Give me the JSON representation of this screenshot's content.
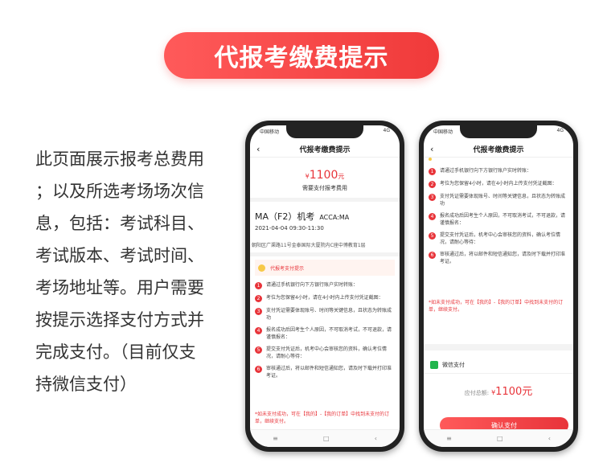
{
  "title": "代报考缴费提示",
  "description_lines": [
    "此页面展示报考总费用",
    "；以及所选考场场次信",
    "息，包括：考试科目、",
    "考试版本、考试时间、",
    "考场地址等。用户需要",
    "按提示选择支付方式并",
    "完成支付。（目前仅支",
    "持微信支付）"
  ],
  "status": {
    "carrier": "中国移动",
    "signal": "4G"
  },
  "page": {
    "back_icon": "‹",
    "nav_title": "代报考缴费提示"
  },
  "summary": {
    "currency": "¥",
    "amount": "1100",
    "unit": "元",
    "subtitle": "需要支付报考费用"
  },
  "exam": {
    "name": "MA（F2）机考",
    "version": "ACCA:MA",
    "time": "2021-04-04 09:30-11:30",
    "address": "朝阳区广渠路11号金泰国际大厦院内C座中博教育1层"
  },
  "tips": {
    "header": "代报考支付提示",
    "steps": [
      "请通过手机银行向下方银行账户实时转账：",
      "考位为您保留4小时，请在4小时内上传支付凭证截图：",
      "支付凭证需要体现账号、时间等关键信息，且状态为转账成功",
      "报名成功后因考生个人原因，不可取消考试，不可退款，请谨慎报名：",
      "提交支付凭证后，机考中心会审核您的资料，确认考位情况，请耐心等待：",
      "审核通过后，将以邮件和短信通知您，请及时下载并打印准考证。"
    ],
    "warning": "*如未支付成功，可在【我的】-【我的订单】中找到未支付的订单，继续支付。"
  },
  "payment": {
    "method": "微信支付",
    "total_label": "应付总额:",
    "currency": "¥",
    "amount": "1100元",
    "confirm_label": "确认支付"
  },
  "bottom_nav": {
    "menu": "≡",
    "home": "□",
    "back": "‹"
  }
}
